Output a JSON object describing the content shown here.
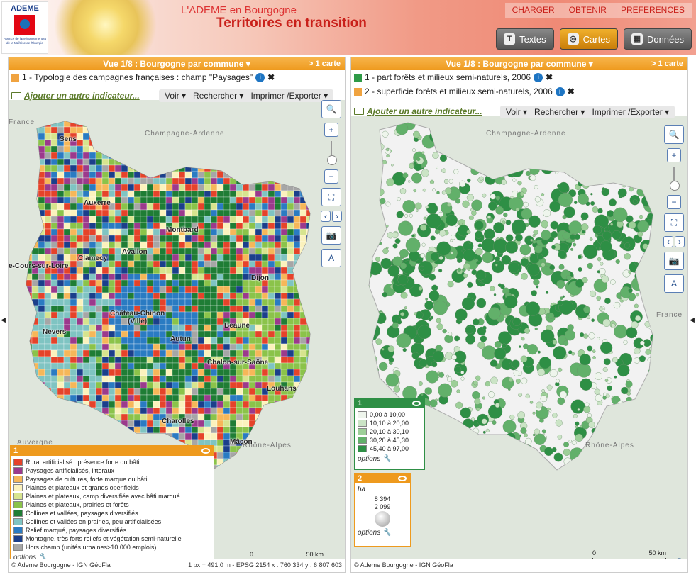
{
  "header": {
    "logo_text": "ADEME",
    "logo_caption": "Agence de l'Environnement et de la Maîtrise de l'Énergie",
    "subtitle": "L'ADEME en Bourgogne",
    "title": "Territoires en transition",
    "menu": [
      "CHARGER",
      "OBTENIR",
      "PREFERENCES"
    ],
    "buttons": [
      {
        "label": "Textes",
        "icon": "T"
      },
      {
        "label": "Cartes",
        "icon": "◎"
      },
      {
        "label": "Données",
        "icon": "▦"
      }
    ]
  },
  "left": {
    "view_title": "Vue 1/8 : Bourgogne par commune ▾",
    "more": "> 1 carte",
    "indicator": "1 - Typologie des campagnes françaises : champ \"Paysages\"",
    "indicator_color": "#f0a340",
    "add_indicator": "Ajouter un autre indicateur...",
    "tools": [
      "Voir ▾",
      "Rechercher ▾",
      "Imprimer /Exporter ▾"
    ],
    "regions": [
      "France",
      "Champagne-Ardenne",
      "Auvergne",
      "Rhône-Alpes"
    ],
    "cities": [
      "Sens",
      "Auxerre",
      "Montbard",
      "Clamecy",
      "Avallon",
      "e-Cours-sur-Loire",
      "Dijon",
      "Château-Chinon\n(Ville)",
      "Nevers",
      "Beaune",
      "Autun",
      "Chalon-sur-Saône",
      "Louhans",
      "Charolles",
      "Mâcon"
    ],
    "legend_title": "1",
    "legend": [
      {
        "label": "Rural artificialisé : présence forte du bâti",
        "color": "#e5432a"
      },
      {
        "label": "Paysages artificialisés, littoraux",
        "color": "#9b3a8c"
      },
      {
        "label": "Paysages de cultures, forte marque du bâti",
        "color": "#f6b759"
      },
      {
        "label": "Plaines et plateaux et grands openfields",
        "color": "#fbf2bd"
      },
      {
        "label": "Plaines et plateaux, camp diversifiée avec bâti marqué",
        "color": "#d7e48e"
      },
      {
        "label": "Plaines et plateaux, prairies et forêts",
        "color": "#8bc34a"
      },
      {
        "label": "Collines et vallées, paysages diversifiés",
        "color": "#1f7d35"
      },
      {
        "label": "Collines et vallées en prairies, peu artificialisées",
        "color": "#7fc4c2"
      },
      {
        "label": "Relief marqué, paysages diversifiés",
        "color": "#2a7bc2"
      },
      {
        "label": "Montagne, très forts reliefs et végétation semi-naturelle",
        "color": "#1b3f8b"
      },
      {
        "label": "Hors champ (unités urbaines>10 000 emplois)",
        "color": "#a6a6a6"
      }
    ],
    "options": "options",
    "scale_0": "0",
    "scale_50": "50 km",
    "footer_left": "© Ademe Bourgogne - IGN GéoFla",
    "footer_right": "1 px = 491,0 m - EPSG 2154   x : 760 334   y : 6 807 603"
  },
  "right": {
    "view_title": "Vue 1/8 : Bourgogne par commune ▾",
    "more": "> 1 carte",
    "indicator1": "1 - part forêts et milieux semi-naturels, 2006",
    "indicator1_color": "#2e9a47",
    "indicator2": "2 - superficie forêts et milieux semi-naturels, 2006",
    "indicator2_color": "#f0a340",
    "add_indicator": "Ajouter un autre indicateur...",
    "tools": [
      "Voir ▾",
      "Rechercher ▾",
      "Imprimer /Exporter ▾"
    ],
    "regions": [
      "Champagne-Ardenne",
      "France",
      "Rhône-Alpes"
    ],
    "legend1_title": "1",
    "legend1": [
      {
        "label": "0,00 à 10,00",
        "color": "#eef5ec"
      },
      {
        "label": "10,10 à 20,00",
        "color": "#cbe4c6"
      },
      {
        "label": "20,10 à 30,10",
        "color": "#9dcf98"
      },
      {
        "label": "30,20 à 45,30",
        "color": "#62b06a"
      },
      {
        "label": "45,40 à 97,00",
        "color": "#2e8f45"
      }
    ],
    "legend2_title": "2",
    "legend2_unit": "ha",
    "legend2_values": [
      "8 394",
      "2 099"
    ],
    "options": "options",
    "scale_0": "0",
    "scale_50": "50 km",
    "footer_left": "© Ademe Bourgogne - IGN GéoFla"
  }
}
